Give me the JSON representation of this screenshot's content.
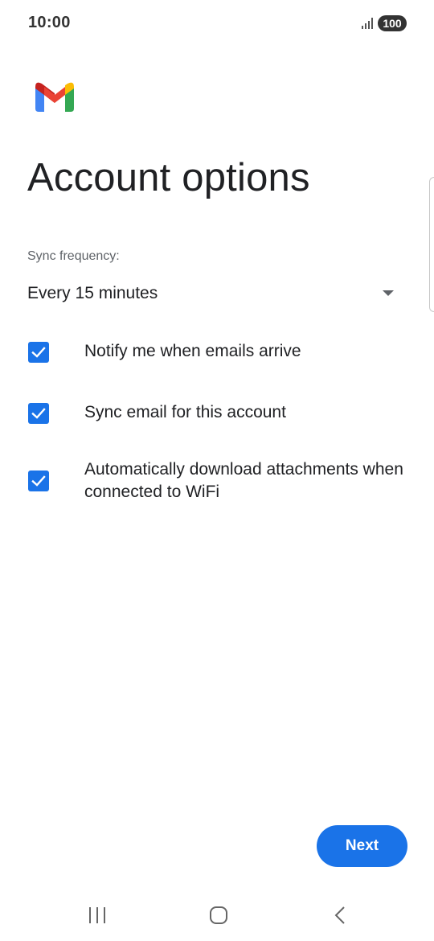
{
  "status_bar": {
    "time": "10:00",
    "battery": "100",
    "signal_icon": "signal-bars-icon"
  },
  "logo": {
    "icon": "gmail-logo-icon",
    "colors": [
      "#4285f4",
      "#ea4335",
      "#fbbc04",
      "#34a853",
      "#c5221f"
    ]
  },
  "page": {
    "title": "Account options"
  },
  "sync": {
    "label": "Sync frequency:",
    "value": "Every 15 minutes"
  },
  "options": [
    {
      "label": "Notify me when emails arrive",
      "checked": true
    },
    {
      "label": "Sync email for this account",
      "checked": true
    },
    {
      "label": "Automatically download attachments when connected to WiFi",
      "checked": true
    }
  ],
  "actions": {
    "next_label": "Next"
  },
  "nav_bar": {
    "recents_icon": "recent-apps-icon",
    "home_icon": "home-icon",
    "back_icon": "back-icon"
  },
  "colors": {
    "accent": "#1a73e8",
    "text_primary": "#202124",
    "text_secondary": "#5f6368"
  }
}
